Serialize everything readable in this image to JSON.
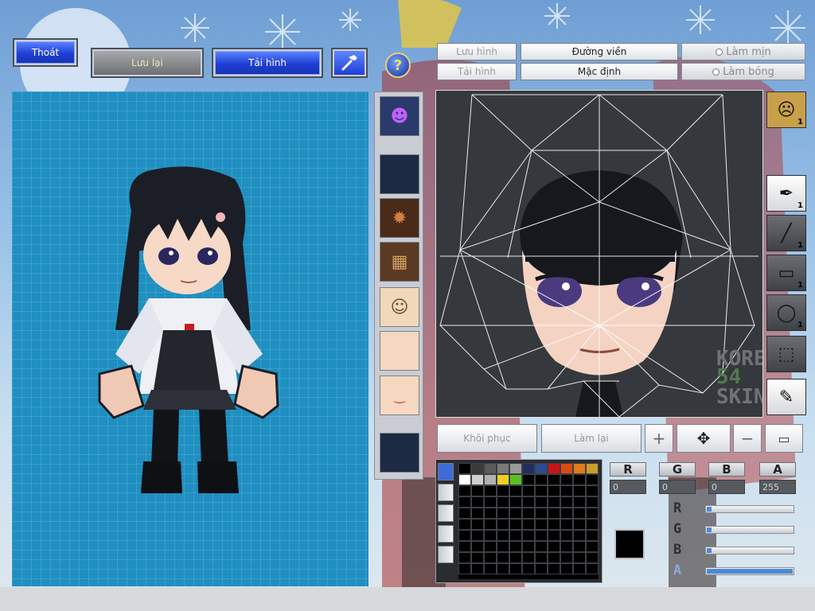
{
  "toolbar": {
    "exit_label": "Thoát",
    "save_label": "Lưu lại",
    "reload_label": "Tải hình",
    "hammer_icon": "hammer-icon",
    "help_icon": "question-icon"
  },
  "editor_tabs": {
    "save_image": "Lưu hình",
    "outline": "Đường viền",
    "load_image": "Tải hình",
    "default": "Mặc định",
    "smooth": "Làm mịn",
    "shiny": "Làm bóng"
  },
  "watermark": {
    "line1": "KORE",
    "line2": "54",
    "line3": "SKIN"
  },
  "tools": [
    {
      "name": "face-tool",
      "count": "1"
    },
    {
      "name": "brush-tool",
      "count": "1"
    },
    {
      "name": "line-tool",
      "count": "1"
    },
    {
      "name": "rect-tool",
      "count": "1"
    },
    {
      "name": "ellipse-tool",
      "count": "1"
    },
    {
      "name": "select-tool",
      "count": ""
    },
    {
      "name": "eyedropper-tool",
      "count": ""
    }
  ],
  "actions": {
    "restore": "Khôi phục",
    "redo": "Làm lại"
  },
  "color": {
    "r_label": "R",
    "g_label": "G",
    "b_label": "B",
    "a_label": "A",
    "r": "0",
    "g": "0",
    "b": "0",
    "a": "255",
    "current": "#000000",
    "r_level": 0.0,
    "g_level": 0.0,
    "b_level": 0.0,
    "a_level": 1.0
  },
  "palette": [
    "#000000",
    "#3a3a3a",
    "#5a5a5a",
    "#7a7a7a",
    "#9a9a9a",
    "#1f2f5a",
    "#2c4c8c",
    "#c81414",
    "#d84a14",
    "#e07a1a",
    "#c8a028",
    "#ffffff",
    "#d0d0d0",
    "#b0b0b0",
    "#f0d020",
    "#58c020",
    "#000000",
    "#000000",
    "#000000",
    "#000000",
    "#000000",
    "#000000"
  ]
}
